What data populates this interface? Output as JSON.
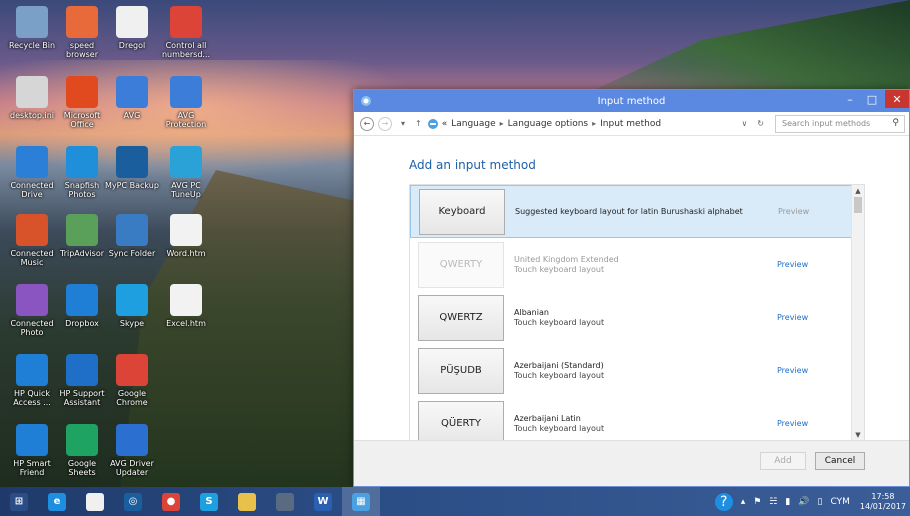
{
  "desktop": {
    "icons": [
      {
        "label": "Recycle Bin",
        "icon": "recycle-bin-icon",
        "color": "#7aa0c8"
      },
      {
        "label": "speed browser",
        "icon": "browser-ball-icon",
        "color": "#e86a3a"
      },
      {
        "label": "Dregol",
        "icon": "document-icon",
        "color": "#f0f0f0"
      },
      {
        "label": "Control all numbersd...",
        "icon": "chrome-icon",
        "color": "#db4437"
      },
      {
        "label": "desktop.ini",
        "icon": "settings-file-icon",
        "color": "#d6d6d6"
      },
      {
        "label": "Microsoft Office",
        "icon": "office-icon",
        "color": "#e04a1e"
      },
      {
        "label": "AVG",
        "icon": "avg-icon",
        "color": "#3b7dd8"
      },
      {
        "label": "AVG Protection",
        "icon": "avg-protection-icon",
        "color": "#3b7dd8"
      },
      {
        "label": "Connected Drive",
        "icon": "cloud-drive-icon",
        "color": "#2b7fd6"
      },
      {
        "label": "Snapfish Photos",
        "icon": "snapfish-icon",
        "color": "#1f8fd9"
      },
      {
        "label": "MyPC Backup",
        "icon": "backup-icon",
        "color": "#1b5e9e"
      },
      {
        "label": "AVG PC TuneUp",
        "icon": "tuneup-icon",
        "color": "#2aa2d8"
      },
      {
        "label": "Connected Music",
        "icon": "music-icon",
        "color": "#d9532a"
      },
      {
        "label": "TripAdvisor",
        "icon": "tripadvisor-icon",
        "color": "#5aa05a"
      },
      {
        "label": "Sync Folder",
        "icon": "sync-folder-icon",
        "color": "#3a7cc4"
      },
      {
        "label": "Word.htm",
        "icon": "html-file-icon",
        "color": "#f2f2f2"
      },
      {
        "label": "Connected Photo",
        "icon": "photo-icon",
        "color": "#8a55c0"
      },
      {
        "label": "Dropbox",
        "icon": "dropbox-icon",
        "color": "#1f7fd6"
      },
      {
        "label": "Skype",
        "icon": "skype-icon",
        "color": "#1ea0e0"
      },
      {
        "label": "Excel.htm",
        "icon": "html-file-icon",
        "color": "#f2f2f2"
      },
      {
        "label": "HP Quick Access ...",
        "icon": "hp-quick-access-icon",
        "color": "#1f7fd6"
      },
      {
        "label": "HP Support Assistant",
        "icon": "help-icon",
        "color": "#1f6fc9"
      },
      {
        "label": "Google Chrome",
        "icon": "chrome-icon",
        "color": "#db4437"
      },
      {
        "label": "HP Smart Friend",
        "icon": "hp-smart-friend-icon",
        "color": "#1f7fd6"
      },
      {
        "label": "Google Sheets",
        "icon": "sheets-icon",
        "color": "#1ea362"
      },
      {
        "label": "AVG Driver Updater",
        "icon": "driver-updater-icon",
        "color": "#2b6fd0"
      }
    ]
  },
  "window": {
    "title": "Input method",
    "address": {
      "prefix": "«",
      "crumbs": [
        "Language",
        "Language options",
        "Input method"
      ],
      "search_placeholder": "Search input methods"
    },
    "heading": "Add an input method",
    "rows": [
      {
        "key": "Keyboard",
        "title": "Suggested keyboard layout for latin Burushaski alphabet",
        "subtitle": "",
        "preview": "Preview",
        "selected": true,
        "dim": false
      },
      {
        "key": "QWERTY",
        "title": "United Kingdom Extended",
        "subtitle": "Touch keyboard layout",
        "preview": "Preview",
        "selected": false,
        "dim": true
      },
      {
        "key": "QWERTZ",
        "title": "Albanian",
        "subtitle": "Touch keyboard layout",
        "preview": "Preview",
        "selected": false,
        "dim": false
      },
      {
        "key": "PÜŞUDB",
        "title": "Azerbaijani (Standard)",
        "subtitle": "Touch keyboard layout",
        "preview": "Preview",
        "selected": false,
        "dim": false
      },
      {
        "key": "QÜERTY",
        "title": "Azerbaijani Latin",
        "subtitle": "Touch keyboard layout",
        "preview": "Preview",
        "selected": false,
        "dim": false
      }
    ],
    "buttons": {
      "add": "Add",
      "cancel": "Cancel"
    }
  },
  "taskbar": {
    "items": [
      {
        "name": "start-button",
        "icon": "windows-logo-icon",
        "color": "#2b4d86"
      },
      {
        "name": "taskbar-ie",
        "icon": "internet-explorer-icon",
        "color": "#1e8fe0"
      },
      {
        "name": "taskbar-file",
        "icon": "document-icon",
        "color": "#f0f0f0"
      },
      {
        "name": "taskbar-backup",
        "icon": "backup-icon",
        "color": "#1b5e9e"
      },
      {
        "name": "taskbar-chrome",
        "icon": "chrome-icon",
        "color": "#db4437"
      },
      {
        "name": "taskbar-skype",
        "icon": "skype-icon",
        "color": "#1ea0e0"
      },
      {
        "name": "taskbar-explorer",
        "icon": "folder-icon",
        "color": "#e8c14a"
      },
      {
        "name": "taskbar-blank",
        "icon": "window-icon",
        "color": "#5a6a80"
      },
      {
        "name": "taskbar-word",
        "icon": "word-icon",
        "color": "#2b5fb0"
      },
      {
        "name": "taskbar-control-panel",
        "icon": "control-panel-icon",
        "color": "#4aa0e0"
      }
    ],
    "tray": {
      "language": "CYM",
      "time": "17:58",
      "date": "14/01/2017"
    }
  },
  "colors": {
    "titlebar": "#5b88e0",
    "link": "#1e6fcc",
    "heading": "#1e5fa8",
    "selection": "#d9ebf9",
    "close": "#c7372f"
  }
}
